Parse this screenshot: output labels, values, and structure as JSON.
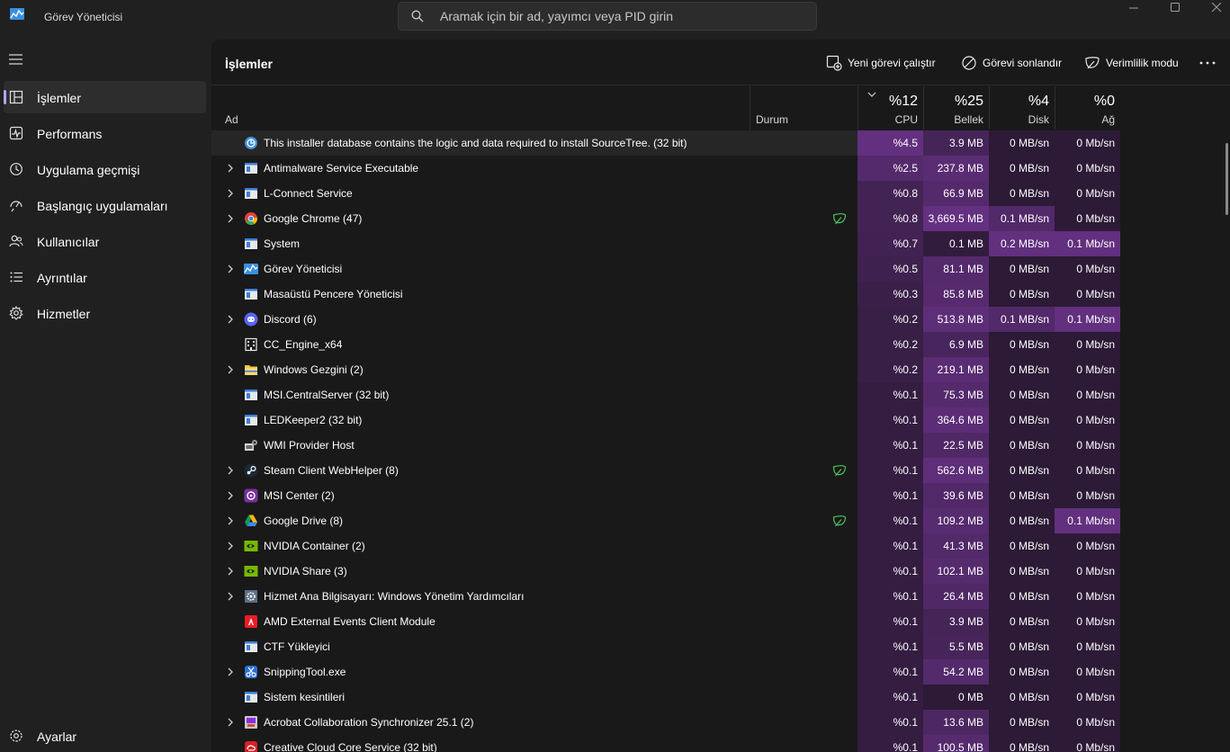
{
  "app": {
    "title": "Görev Yöneticisi",
    "icon": "task-manager-icon"
  },
  "search": {
    "placeholder": "Aramak için bir ad, yayımcı veya PID girin"
  },
  "sidebar": {
    "items": [
      {
        "label": "İşlemler",
        "icon": "processes-icon",
        "active": true
      },
      {
        "label": "Performans",
        "icon": "performance-icon",
        "active": false
      },
      {
        "label": "Uygulama geçmişi",
        "icon": "app-history-icon",
        "active": false
      },
      {
        "label": "Başlangıç uygulamaları",
        "icon": "startup-apps-icon",
        "active": false
      },
      {
        "label": "Kullanıcılar",
        "icon": "users-icon",
        "active": false
      },
      {
        "label": "Ayrıntılar",
        "icon": "details-icon",
        "active": false
      },
      {
        "label": "Hizmetler",
        "icon": "services-icon",
        "active": false
      }
    ],
    "settings_label": "Ayarlar"
  },
  "toolbar": {
    "title": "İşlemler",
    "new_task_label": "Yeni görevi çalıştır",
    "end_task_label": "Görevi sonlandır",
    "efficiency_label": "Verimlilik modu"
  },
  "columns": {
    "name": "Ad",
    "status": "Durum",
    "cpu": {
      "percent": "%12",
      "label": "CPU"
    },
    "memory": {
      "percent": "%25",
      "label": "Bellek"
    },
    "disk": {
      "percent": "%4",
      "label": "Disk"
    },
    "network": {
      "percent": "%0",
      "label": "Ağ"
    }
  },
  "colors": {
    "accent": "#a9a9f5",
    "heat_low": "#2c1a36",
    "heat_mid": "#4a2660",
    "heat_high": "#5c2d78",
    "eco_leaf": "#4cc35a"
  },
  "processes": [
    {
      "name": "This installer database contains the logic and data required to install SourceTree. (32 bit)",
      "icon": "installer-icon",
      "expandable": false,
      "eco": false,
      "cpu": "%4.5",
      "memory": "3.9 MB",
      "disk": "0 MB/sn",
      "network": "0 Mb/sn",
      "selected": true
    },
    {
      "name": "Antimalware Service Executable",
      "icon": "window-app-icon",
      "expandable": true,
      "eco": false,
      "cpu": "%2.5",
      "memory": "237.8 MB",
      "disk": "0 MB/sn",
      "network": "0 Mb/sn"
    },
    {
      "name": "L-Connect Service",
      "icon": "window-app-icon",
      "expandable": true,
      "eco": false,
      "cpu": "%0.8",
      "memory": "66.9 MB",
      "disk": "0 MB/sn",
      "network": "0 Mb/sn"
    },
    {
      "name": "Google Chrome (47)",
      "icon": "chrome-icon",
      "expandable": true,
      "eco": true,
      "cpu": "%0.8",
      "memory": "3,669.5 MB",
      "disk": "0.1 MB/sn",
      "network": "0 Mb/sn"
    },
    {
      "name": "System",
      "icon": "window-app-icon",
      "expandable": false,
      "eco": false,
      "cpu": "%0.7",
      "memory": "0.1 MB",
      "disk": "0.2 MB/sn",
      "network": "0.1 Mb/sn"
    },
    {
      "name": "Görev Yöneticisi",
      "icon": "task-manager-icon",
      "expandable": true,
      "eco": false,
      "cpu": "%0.5",
      "memory": "81.1 MB",
      "disk": "0 MB/sn",
      "network": "0 Mb/sn"
    },
    {
      "name": "Masaüstü Pencere Yöneticisi",
      "icon": "window-app-icon",
      "expandable": false,
      "eco": false,
      "cpu": "%0.3",
      "memory": "85.8 MB",
      "disk": "0 MB/sn",
      "network": "0 Mb/sn"
    },
    {
      "name": "Discord (6)",
      "icon": "discord-icon",
      "expandable": true,
      "eco": false,
      "cpu": "%0.2",
      "memory": "513.8 MB",
      "disk": "0.1 MB/sn",
      "network": "0.1 Mb/sn"
    },
    {
      "name": "CC_Engine_x64",
      "icon": "building-icon",
      "expandable": false,
      "eco": false,
      "cpu": "%0.2",
      "memory": "6.9 MB",
      "disk": "0 MB/sn",
      "network": "0 Mb/sn"
    },
    {
      "name": "Windows Gezgini (2)",
      "icon": "folder-icon",
      "expandable": true,
      "eco": false,
      "cpu": "%0.2",
      "memory": "219.1 MB",
      "disk": "0 MB/sn",
      "network": "0 Mb/sn"
    },
    {
      "name": "MSI.CentralServer (32 bit)",
      "icon": "window-app-icon",
      "expandable": false,
      "eco": false,
      "cpu": "%0.1",
      "memory": "75.3 MB",
      "disk": "0 MB/sn",
      "network": "0 Mb/sn"
    },
    {
      "name": "LEDKeeper2 (32 bit)",
      "icon": "window-app-icon",
      "expandable": false,
      "eco": false,
      "cpu": "%0.1",
      "memory": "364.6 MB",
      "disk": "0 MB/sn",
      "network": "0 Mb/sn"
    },
    {
      "name": "WMI Provider Host",
      "icon": "wmi-icon",
      "expandable": false,
      "eco": false,
      "cpu": "%0.1",
      "memory": "22.5 MB",
      "disk": "0 MB/sn",
      "network": "0 Mb/sn"
    },
    {
      "name": "Steam Client WebHelper (8)",
      "icon": "steam-icon",
      "expandable": true,
      "eco": true,
      "cpu": "%0.1",
      "memory": "562.6 MB",
      "disk": "0 MB/sn",
      "network": "0 Mb/sn"
    },
    {
      "name": "MSI Center (2)",
      "icon": "msi-center-icon",
      "expandable": true,
      "eco": false,
      "cpu": "%0.1",
      "memory": "39.6 MB",
      "disk": "0 MB/sn",
      "network": "0 Mb/sn"
    },
    {
      "name": "Google Drive (8)",
      "icon": "google-drive-icon",
      "expandable": true,
      "eco": true,
      "cpu": "%0.1",
      "memory": "109.2 MB",
      "disk": "0 MB/sn",
      "network": "0.1 Mb/sn"
    },
    {
      "name": "NVIDIA Container (2)",
      "icon": "nvidia-icon",
      "expandable": true,
      "eco": false,
      "cpu": "%0.1",
      "memory": "41.3 MB",
      "disk": "0 MB/sn",
      "network": "0 Mb/sn"
    },
    {
      "name": "NVIDIA Share (3)",
      "icon": "nvidia-icon",
      "expandable": true,
      "eco": false,
      "cpu": "%0.1",
      "memory": "102.1 MB",
      "disk": "0 MB/sn",
      "network": "0 Mb/sn"
    },
    {
      "name": "Hizmet Ana Bilgisayarı: Windows Yönetim Yardımcıları",
      "icon": "service-gear-icon",
      "expandable": true,
      "eco": false,
      "cpu": "%0.1",
      "memory": "26.4 MB",
      "disk": "0 MB/sn",
      "network": "0 Mb/sn"
    },
    {
      "name": "AMD External Events Client Module",
      "icon": "amd-icon",
      "expandable": false,
      "eco": false,
      "cpu": "%0.1",
      "memory": "3.9 MB",
      "disk": "0 MB/sn",
      "network": "0 Mb/sn"
    },
    {
      "name": "CTF Yükleyici",
      "icon": "window-app-icon",
      "expandable": false,
      "eco": false,
      "cpu": "%0.1",
      "memory": "5.5 MB",
      "disk": "0 MB/sn",
      "network": "0 Mb/sn"
    },
    {
      "name": "SnippingTool.exe",
      "icon": "snipping-tool-icon",
      "expandable": true,
      "eco": false,
      "cpu": "%0.1",
      "memory": "54.2 MB",
      "disk": "0 MB/sn",
      "network": "0 Mb/sn"
    },
    {
      "name": "Sistem kesintileri",
      "icon": "window-app-icon",
      "expandable": false,
      "eco": false,
      "cpu": "%0.1",
      "memory": "0 MB",
      "disk": "0 MB/sn",
      "network": "0 Mb/sn"
    },
    {
      "name": "Acrobat Collaboration Synchronizer 25.1 (2)",
      "icon": "acrobat-icon",
      "expandable": true,
      "eco": false,
      "cpu": "%0.1",
      "memory": "13.6 MB",
      "disk": "0 MB/sn",
      "network": "0 Mb/sn"
    },
    {
      "name": "Creative Cloud Core Service (32 bit)",
      "icon": "creative-cloud-icon",
      "expandable": false,
      "eco": false,
      "cpu": "%0.1",
      "memory": "100.5 MB",
      "disk": "0 MB/sn",
      "network": "0 Mb/sn"
    }
  ]
}
